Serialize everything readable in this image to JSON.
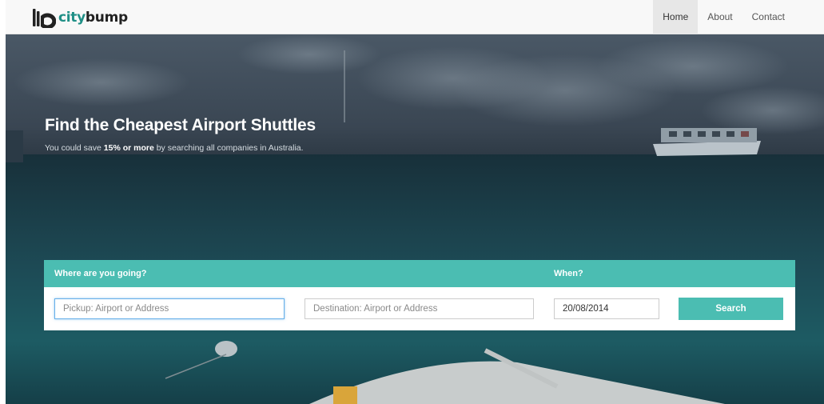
{
  "brand": {
    "part1": "city",
    "part2": "bump",
    "colors": {
      "teal": "#1f8f86",
      "dark": "#222222"
    }
  },
  "nav": {
    "items": [
      {
        "label": "Home",
        "active": true
      },
      {
        "label": "About",
        "active": false
      },
      {
        "label": "Contact",
        "active": false
      }
    ]
  },
  "hero": {
    "title": "Find the Cheapest Airport Shuttles",
    "subtitle_before": "You could save ",
    "subtitle_bold": "15% or more",
    "subtitle_after": " by searching all companies in Australia."
  },
  "search": {
    "where_label": "Where are you going?",
    "when_label": "When?",
    "pickup_placeholder": "Pickup: Airport or Address",
    "destination_placeholder": "Destination: Airport or Address",
    "date_value": "20/08/2014",
    "button_label": "Search",
    "accent_color": "#4bbdb2"
  }
}
